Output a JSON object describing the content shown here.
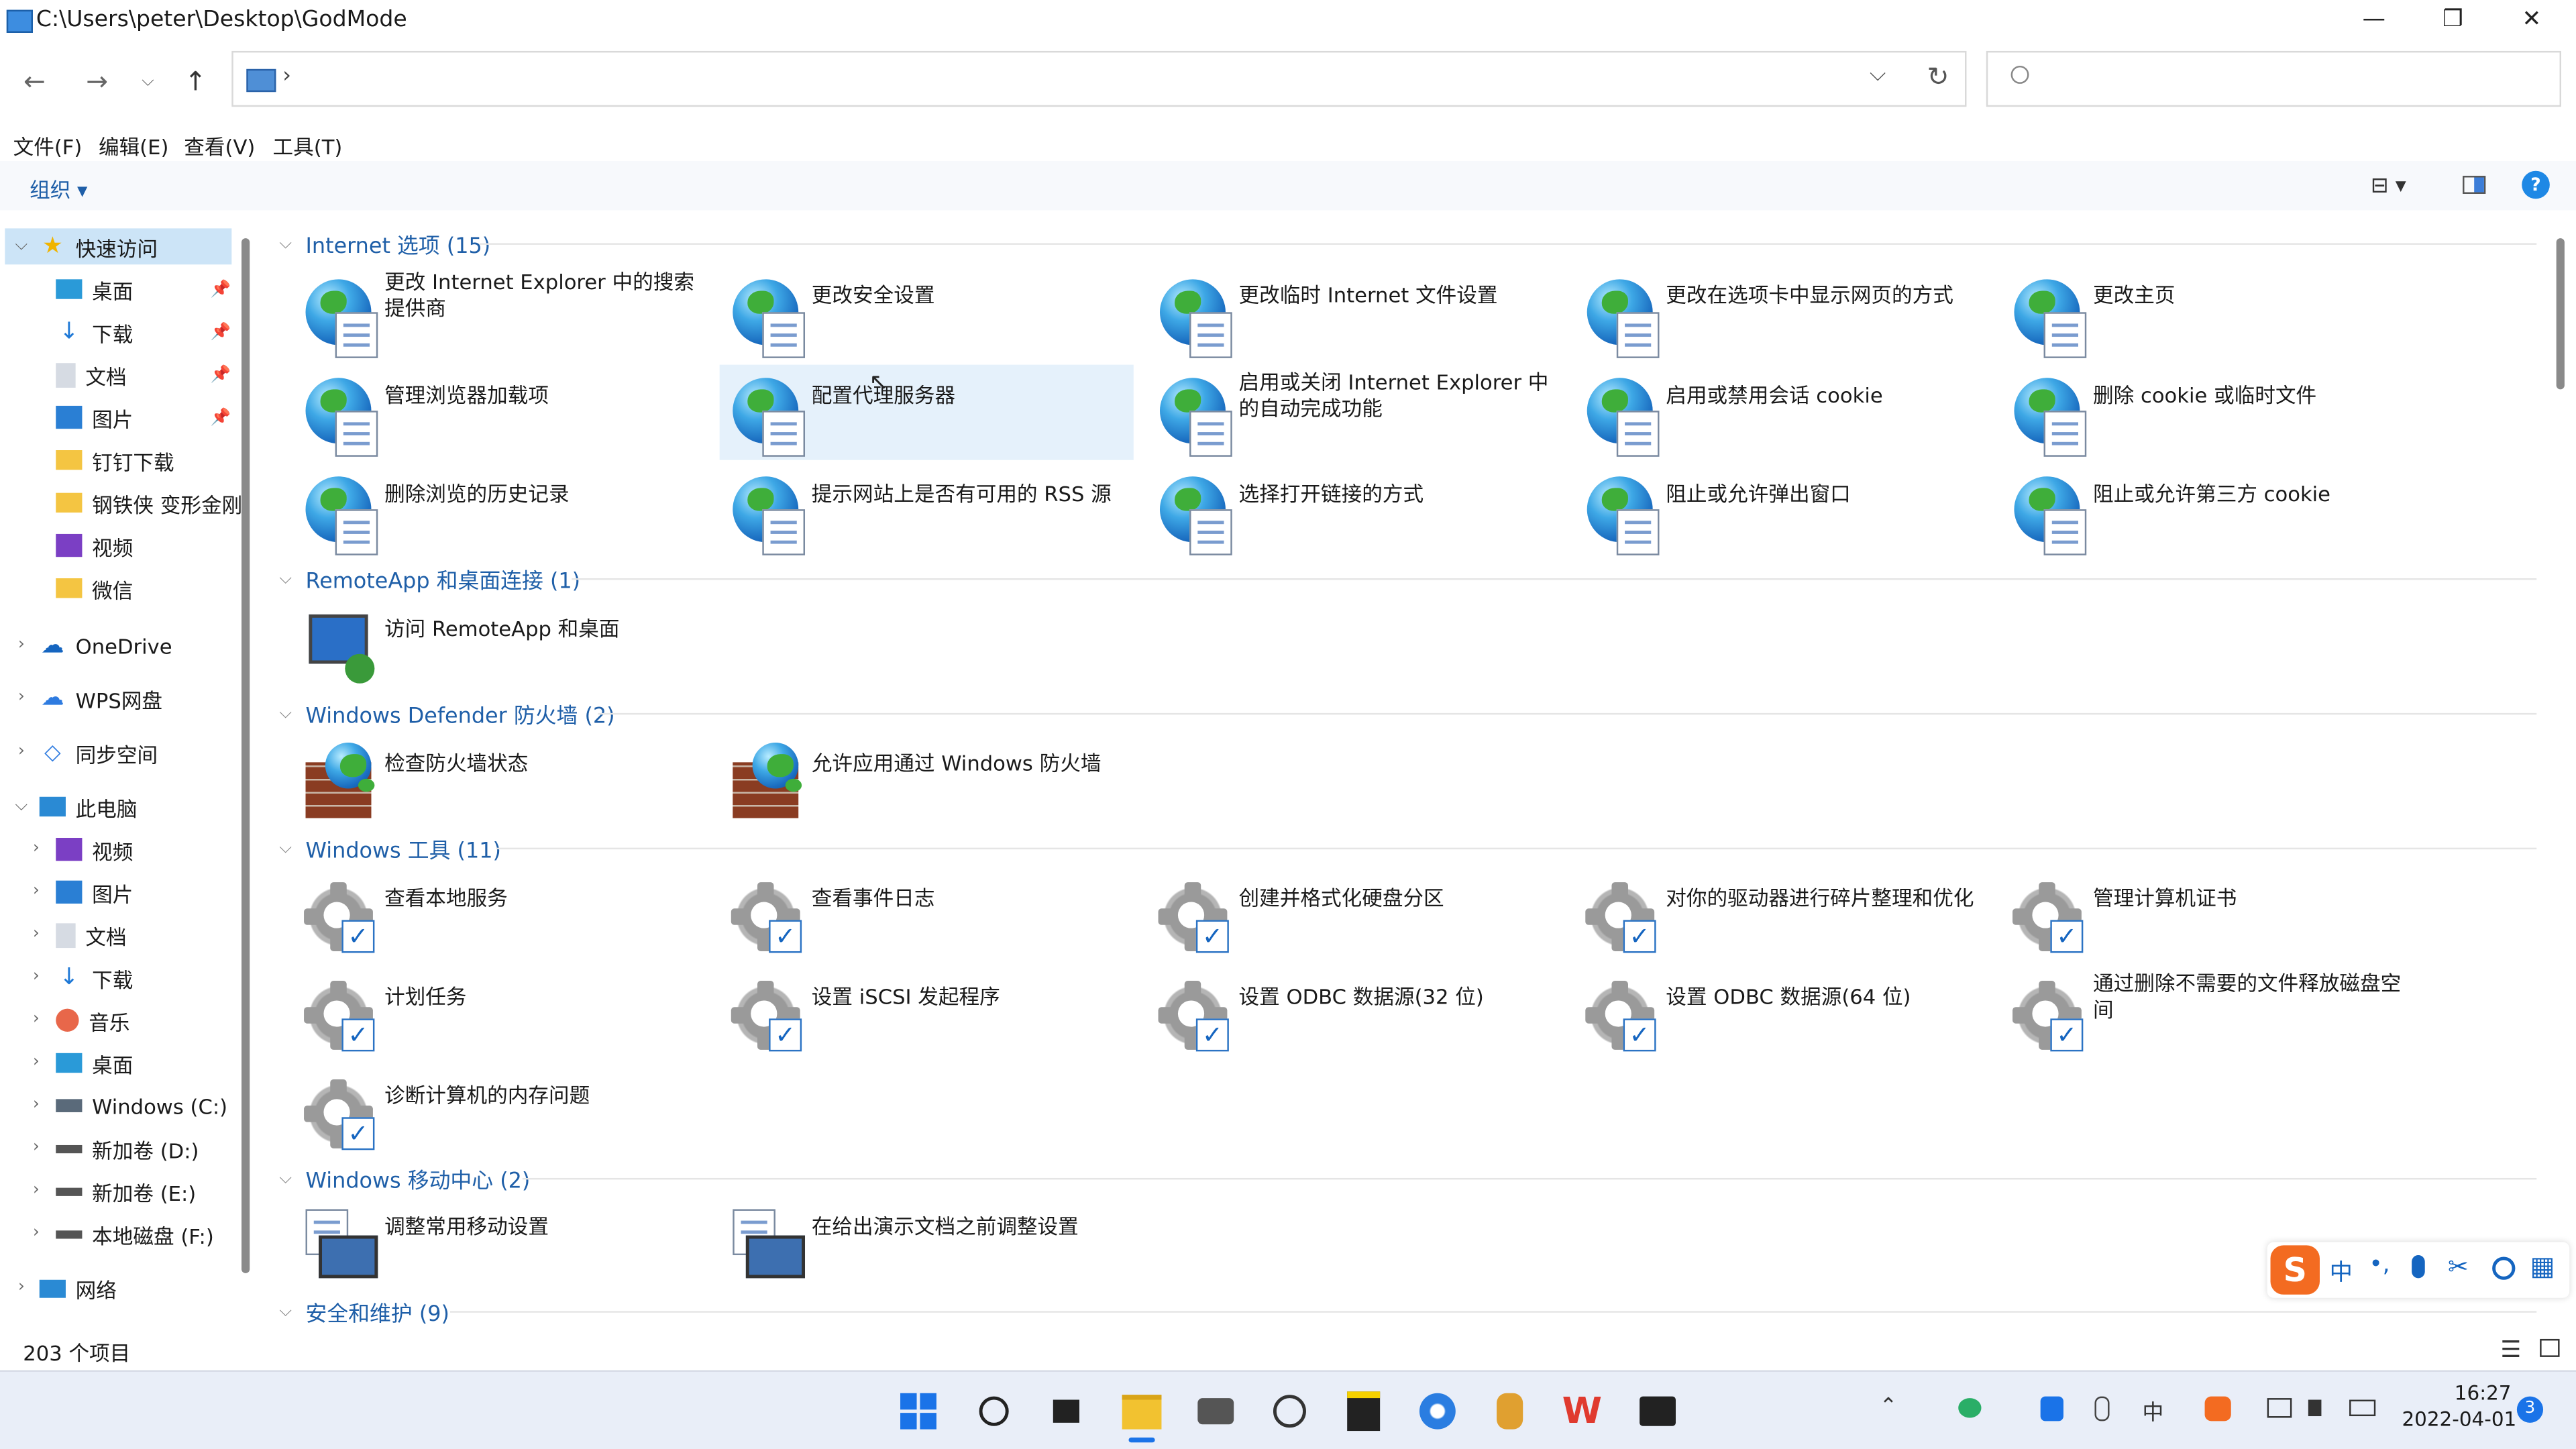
{
  "window": {
    "title": "C:\\Users\\peter\\Desktop\\GodMode",
    "minimize_glyph": "—",
    "restore_glyph": "❐",
    "close_glyph": "✕"
  },
  "address": {
    "chevron": "›",
    "dropdown_glyph": "⌵",
    "refresh_glyph": "↻"
  },
  "menu": {
    "file": "文件(F)",
    "edit": "编辑(E)",
    "view": "查看(V)",
    "tools": "工具(T)"
  },
  "toolbar": {
    "organize": "组织 ▾"
  },
  "sidebar": {
    "quick_access": "快速访问",
    "quick_items": [
      "桌面",
      "下载",
      "文档",
      "图片",
      "钉钉下载",
      "钢铁侠 变形金刚",
      "视频",
      "微信"
    ],
    "onedrive": "OneDrive",
    "wps": "WPS网盘",
    "sync": "同步空间",
    "this_pc": "此电脑",
    "pc_items": [
      "视频",
      "图片",
      "文档",
      "下载",
      "音乐",
      "桌面",
      "Windows (C:)",
      "新加卷 (D:)",
      "新加卷 (E:)",
      "本地磁盘 (F:)"
    ],
    "network": "网络"
  },
  "groups": {
    "internet": {
      "title": "Internet 选项 (15)",
      "items": [
        "更改 Internet Explorer 中的搜索提供商",
        "更改安全设置",
        "更改临时 Internet 文件设置",
        "更改在选项卡中显示网页的方式",
        "更改主页",
        "管理浏览器加载项",
        "配置代理服务器",
        "启用或关闭 Internet Explorer 中的自动完成功能",
        "启用或禁用会话 cookie",
        "删除 cookie 或临时文件",
        "删除浏览的历史记录",
        "提示网站上是否有可用的 RSS 源",
        "选择打开链接的方式",
        "阻止或允许弹出窗口",
        "阻止或允许第三方 cookie"
      ]
    },
    "remoteapp": {
      "title": "RemoteApp 和桌面连接 (1)",
      "items": [
        "访问 RemoteApp 和桌面"
      ]
    },
    "firewall": {
      "title": "Windows Defender 防火墙 (2)",
      "items": [
        "检查防火墙状态",
        "允许应用通过 Windows 防火墙"
      ]
    },
    "tools": {
      "title": "Windows 工具 (11)",
      "items": [
        "查看本地服务",
        "查看事件日志",
        "创建并格式化硬盘分区",
        "对你的驱动器进行碎片整理和优化",
        "管理计算机证书",
        "计划任务",
        "设置 iSCSI 发起程序",
        "设置 ODBC 数据源(32 位)",
        "设置 ODBC 数据源(64 位)",
        "通过删除不需要的文件释放磁盘空间",
        "诊断计算机的内存问题"
      ]
    },
    "mobility": {
      "title": "Windows 移动中心 (2)",
      "items": [
        "调整常用移动设置",
        "在给出演示文档之前调整设置"
      ]
    },
    "security": {
      "title": "安全和维护 (9)"
    }
  },
  "status": {
    "count": "203 个项目"
  },
  "ime": {
    "label": "中",
    "punct": "•,",
    "mic": "🎤",
    "scissors": "✂",
    "search": "🔍",
    "grid": "▦"
  },
  "taskbar": {
    "time": "16:27",
    "date": "2022-04-01",
    "notifications": "3",
    "icons": [
      "⊞",
      "🔍",
      "▮",
      "📁",
      "📷",
      "⏱",
      "◩",
      "🌐",
      "🤖",
      "W",
      "⚙"
    ],
    "tray_up": "⌃",
    "tray_lang": "中"
  },
  "colors": {
    "accent": "#1f5fa8",
    "selection": "#e5f1fb",
    "taskbar": "#e9eef8"
  }
}
